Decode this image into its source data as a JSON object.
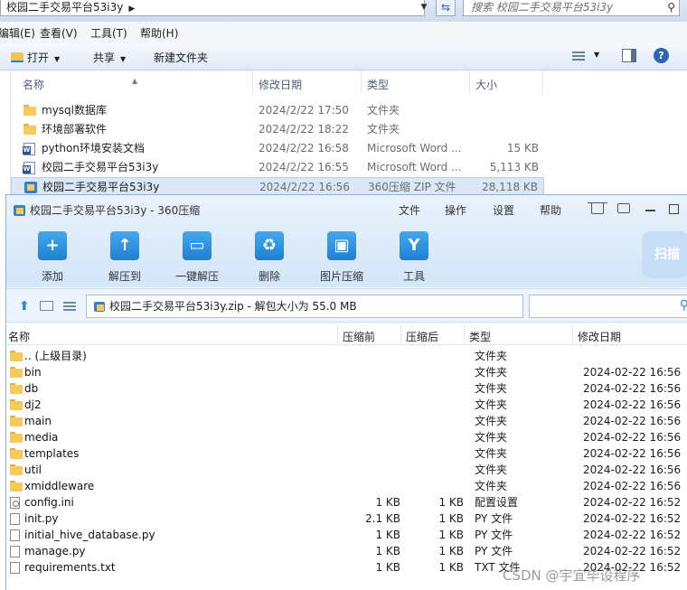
{
  "explorer": {
    "breadcrumb": "校园二手交易平台53i3y",
    "search_placeholder": "搜索 校园二手交易平台53i3y",
    "menu": [
      "编辑(E)",
      "查看(V)",
      "工具(T)",
      "帮助(H)"
    ],
    "commands": {
      "open": "打开",
      "share": "共享",
      "new_folder": "新建文件夹"
    },
    "columns": {
      "name": "名称",
      "date": "修改日期",
      "type": "类型",
      "size": "大小"
    },
    "rows": [
      {
        "icon": "folder-icon",
        "name": "mysql数据库",
        "date": "2024/2/22 17:50",
        "type": "文件夹",
        "size": ""
      },
      {
        "icon": "folder-icon",
        "name": "环境部署软件",
        "date": "2024/2/22 18:22",
        "type": "文件夹",
        "size": ""
      },
      {
        "icon": "word-icon",
        "name": "python环境安装文档",
        "date": "2024/2/22 16:58",
        "type": "Microsoft Word ...",
        "size": "15 KB"
      },
      {
        "icon": "word-icon",
        "name": "校园二手交易平台53i3y",
        "date": "2024/2/22 16:55",
        "type": "Microsoft Word ...",
        "size": "5,113 KB"
      },
      {
        "icon": "zip-icon",
        "name": "校园二手交易平台53i3y",
        "date": "2024/2/22 16:56",
        "type": "360压缩 ZIP 文件",
        "size": "28,118 KB",
        "selected": true
      }
    ]
  },
  "zip": {
    "title": "校园二手交易平台53i3y - 360压缩",
    "menu": [
      "文件",
      "操作",
      "设置",
      "帮助"
    ],
    "tools": [
      {
        "label": "添加",
        "icon": "add-icon",
        "glyph": "+"
      },
      {
        "label": "解压到",
        "icon": "extract-to-icon",
        "glyph": "↑"
      },
      {
        "label": "一键解压",
        "icon": "one-click-extract-icon",
        "glyph": "▭"
      },
      {
        "label": "删除",
        "icon": "delete-icon",
        "glyph": "♻"
      },
      {
        "label": "图片压缩",
        "icon": "image-compress-icon",
        "glyph": "▣"
      },
      {
        "label": "工具",
        "icon": "tools-icon",
        "glyph": "Y"
      }
    ],
    "scan_label": "扫描",
    "path": "校园二手交易平台53i3y.zip - 解包大小为 55.0 MB",
    "columns": {
      "name": "名称",
      "compressed": "压缩前",
      "uncompressed": "压缩后",
      "type": "类型",
      "date": "修改日期"
    },
    "rows": [
      {
        "icon": "folder-icon",
        "name": ".. (上级目录)",
        "c": "",
        "u": "",
        "type": "文件夹",
        "date": ""
      },
      {
        "icon": "folder-icon",
        "name": "bin",
        "c": "",
        "u": "",
        "type": "文件夹",
        "date": "2024-02-22 16:56"
      },
      {
        "icon": "folder-icon",
        "name": "db",
        "c": "",
        "u": "",
        "type": "文件夹",
        "date": "2024-02-22 16:56"
      },
      {
        "icon": "folder-icon",
        "name": "dj2",
        "c": "",
        "u": "",
        "type": "文件夹",
        "date": "2024-02-22 16:56"
      },
      {
        "icon": "folder-icon",
        "name": "main",
        "c": "",
        "u": "",
        "type": "文件夹",
        "date": "2024-02-22 16:56"
      },
      {
        "icon": "folder-icon",
        "name": "media",
        "c": "",
        "u": "",
        "type": "文件夹",
        "date": "2024-02-22 16:56"
      },
      {
        "icon": "folder-icon",
        "name": "templates",
        "c": "",
        "u": "",
        "type": "文件夹",
        "date": "2024-02-22 16:56"
      },
      {
        "icon": "folder-icon",
        "name": "util",
        "c": "",
        "u": "",
        "type": "文件夹",
        "date": "2024-02-22 16:56"
      },
      {
        "icon": "folder-icon",
        "name": "xmiddleware",
        "c": "",
        "u": "",
        "type": "文件夹",
        "date": "2024-02-22 16:56"
      },
      {
        "icon": "ini-icon",
        "name": "config.ini",
        "c": "1 KB",
        "u": "1 KB",
        "type": "配置设置",
        "date": "2024-02-22 16:52"
      },
      {
        "icon": "file-icon",
        "name": "init.py",
        "c": "2.1 KB",
        "u": "1 KB",
        "type": "PY 文件",
        "date": "2024-02-22 16:52"
      },
      {
        "icon": "file-icon",
        "name": "initial_hive_database.py",
        "c": "1 KB",
        "u": "1 KB",
        "type": "PY 文件",
        "date": "2024-02-22 16:52"
      },
      {
        "icon": "file-icon",
        "name": "manage.py",
        "c": "1 KB",
        "u": "1 KB",
        "type": "PY 文件",
        "date": "2024-02-22 16:52"
      },
      {
        "icon": "file-icon",
        "name": "requirements.txt",
        "c": "1 KB",
        "u": "1 KB",
        "type": "TXT 文件",
        "date": "2024-02-22 16:52"
      }
    ]
  },
  "watermark": "CSDN @宇宜毕设程序"
}
